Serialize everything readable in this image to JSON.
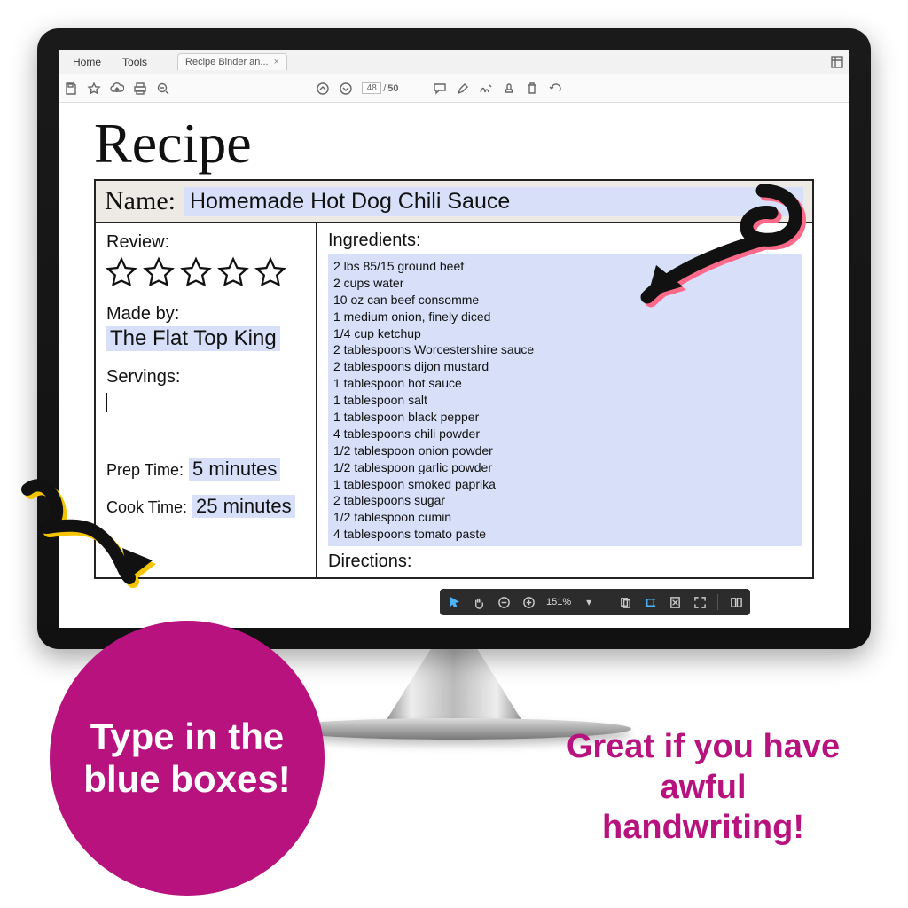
{
  "menu": {
    "home": "Home",
    "tools": "Tools"
  },
  "tab": {
    "title": "Recipe Binder an..."
  },
  "pages": {
    "current": "48",
    "total": "50",
    "sep": "/"
  },
  "doc": {
    "heading": "Recipe",
    "name_label": "Name:",
    "name_value": "Homemade Hot Dog Chili Sauce",
    "review_label": "Review:",
    "madeby_label": "Made by:",
    "madeby_value": "The Flat Top King",
    "servings_label": "Servings:",
    "prep_label": "Prep Time:",
    "prep_value": "5 minutes",
    "cook_label": "Cook Time:",
    "cook_value": "25 minutes",
    "ingredients_label": "Ingredients:",
    "directions_label": "Directions:",
    "ingredients": "2 lbs 85/15 ground beef\n2 cups water\n10 oz can beef consomme\n1 medium onion, finely diced\n1/4 cup ketchup\n2 tablespoons Worcestershire sauce\n2 tablespoons dijon mustard\n1 tablespoon hot sauce\n1 tablespoon salt\n1 tablespoon black pepper\n4 tablespoons chili powder\n1/2 tablespoon onion powder\n1/2 tablespoon garlic powder\n1 tablespoon smoked paprika\n2 tablespoons sugar\n1/2 tablespoon cumin\n4 tablespoons tomato paste"
  },
  "viewbar": {
    "zoom": "151%"
  },
  "promo": {
    "circle": "Type in the blue boxes!",
    "tagline": "Great if you have awful handwriting!"
  }
}
